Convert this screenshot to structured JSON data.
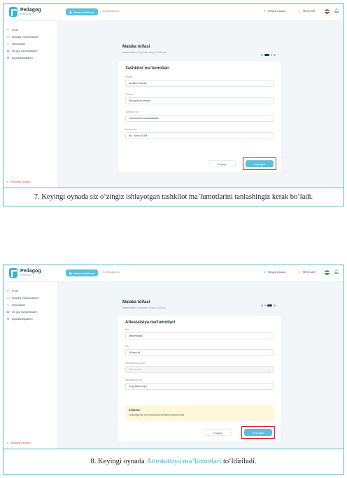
{
  "app": {
    "logo_title": "Pedagog",
    "logo_sub": "Platforma",
    "nav_active": "Malaka toifalarim",
    "nav_link": "Sertifikatlarim",
    "telegram": "Telegram kanal",
    "tests": "TESTLAR",
    "colors": {
      "accent": "#5bc0d8",
      "highlight": "#e11d2a",
      "flag_blue": "#1eb4e6",
      "flag_white": "#ffffff",
      "flag_green": "#1eb53a"
    },
    "sidebar": [
      {
        "label": "Profil",
        "icon": "user-icon"
      },
      {
        "label": "Shaxsiy ma'lumotlarim",
        "icon": "id-card-icon"
      },
      {
        "label": "Intiyozlarim",
        "icon": "star-icon"
      },
      {
        "label": "Ish joyi ma'lumotlarim",
        "icon": "briefcase-icon"
      },
      {
        "label": "Ayonlashtiyalarim",
        "icon": "gear-icon"
      }
    ],
    "logout": "Tizimdan chiqish"
  },
  "screen1": {
    "page_title": "Malaka toifasi",
    "page_sub": "Matematika | To'g'ridan-to'g'ri | 2026-yil",
    "card_title": "Tashkilot ma'lumotlari",
    "fields": [
      {
        "label": "Viloyat",
        "value": "Andijon viloyati"
      },
      {
        "label": "Tuman",
        "value": "Buloqboshi tumani"
      },
      {
        "label": "Tashkilot turi",
        "value": "Umumta'lim muassasalari"
      },
      {
        "label": "Muassasa",
        "value": "68 - sonli IDUM"
      }
    ],
    "back_label": "Orqaga",
    "next_label": "Keyingisi"
  },
  "caption1": "7. Keyingi oynada siz o‘zingiz ishlayotgan tashkilot ma’lumotlarini tanlashingiz kerak bo‘ladi.",
  "screen2": {
    "page_title": "Malaka toifasi",
    "page_sub": "Matematika | To'g'ridan-to'g'ri | 2026-yil",
    "card_title": "Attestatsiya ma'lumotlari",
    "fields": [
      {
        "label": "Fan",
        "value": "Matematika",
        "disabled": false
      },
      {
        "label": "Tilni",
        "value": "O'zbek tili",
        "disabled": false
      },
      {
        "label": "Attestatsiya toifasi",
        "value": "Mutaxassis",
        "disabled": true
      },
      {
        "label": "Attestatsiya turi",
        "value": "To'g'ridan-to'g'ri",
        "disabled": false
      }
    ],
    "alert_title": "Eslatma!",
    "alert_text": "Tanlangan fan bo'yicha bazali sertifikat mavjud emas.",
    "back_label": "Orqaga",
    "next_label": "Keyingisi"
  },
  "caption2": {
    "before": "8. Keyingi oynada ",
    "accent": "Attestatsiya ma’lumotlari",
    "after": " to‘ldiriladi."
  }
}
